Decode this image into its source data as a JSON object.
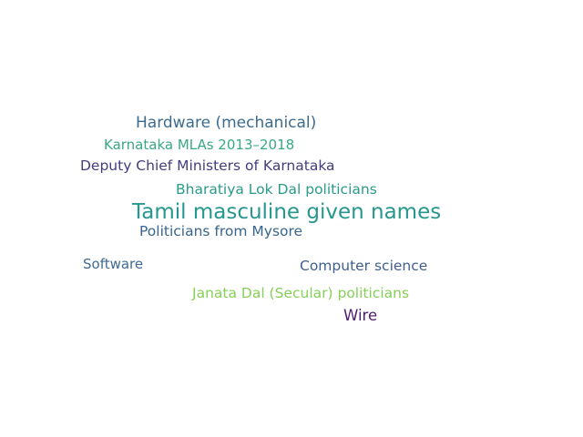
{
  "words": [
    {
      "text": "Hardware (mechanical)",
      "color": "#3b6b8f"
    },
    {
      "text": "Karnataka MLAs 2013–2018",
      "color": "#3aa882"
    },
    {
      "text": "Deputy Chief Ministers of Karnataka",
      "color": "#433d7e"
    },
    {
      "text": "Bharatiya Lok Dal politicians",
      "color": "#2a9a8a"
    },
    {
      "text": "Tamil masculine given names",
      "color": "#26978e"
    },
    {
      "text": "Politicians from Mysore",
      "color": "#37658d"
    },
    {
      "text": "Software",
      "color": "#3e6a92"
    },
    {
      "text": "Computer science",
      "color": "#3f5f90"
    },
    {
      "text": "Janata Dal (Secular) politicians",
      "color": "#86cf58"
    },
    {
      "text": "Wire",
      "color": "#4d1c6e"
    }
  ]
}
